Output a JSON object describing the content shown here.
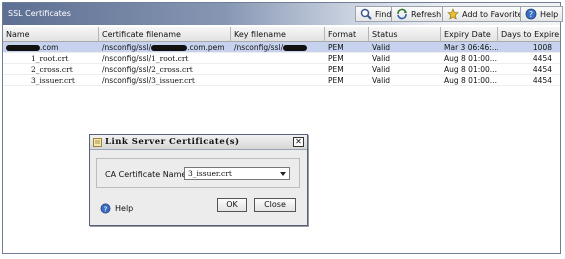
{
  "window": {
    "title": "SSL Certificates"
  },
  "toolbar": {
    "find_label": "Find",
    "refresh_label": "Refresh",
    "favorites_label": "Add to Favorites",
    "help_label": "Help"
  },
  "table": {
    "columns": [
      "Name",
      "Certificate filename",
      "Key filename",
      "Format",
      "Status",
      "Expiry Date",
      "Days to Expire"
    ],
    "rows": [
      {
        "name": ".com",
        "cert": "/nsconfig/ssl/",
        "cert2": ".com.pem",
        "key": "/nsconfig/ssl/",
        "format": "PEM",
        "status": "Valid",
        "expiry": "Mar  3 06:46:...",
        "days": "1008",
        "selected": true
      },
      {
        "name": "1_root.crt",
        "cert": "/nsconfig/ssl/",
        "cert2": "1_root.crt",
        "key": "",
        "format": "PEM",
        "status": "Valid",
        "expiry": "Aug  8 01:00...",
        "days": "4454",
        "selected": false
      },
      {
        "name": "2_cross.crt",
        "cert": "/nsconfig/ssl/",
        "cert2": "2_cross.crt",
        "key": "",
        "format": "PEM",
        "status": "Valid",
        "expiry": "Aug  8 01:00...",
        "days": "4454",
        "selected": false
      },
      {
        "name": "3_issuer.crt",
        "cert": "/nsconfig/ssl/",
        "cert2": "3_issuer.crt",
        "key": "",
        "format": "PEM",
        "status": "Valid",
        "expiry": "Aug  8 01:00...",
        "days": "4454",
        "selected": false
      }
    ]
  },
  "dialog": {
    "title": "Link Server Certificate(s)",
    "ca_label": "CA Certificate Name",
    "ca_value": "3_issuer.crt",
    "help_label": "Help",
    "ok_label": "OK",
    "close_label": "Close"
  },
  "colors": {
    "selection": "#c6d2ee",
    "titlebar_start": "#5d6f92"
  }
}
